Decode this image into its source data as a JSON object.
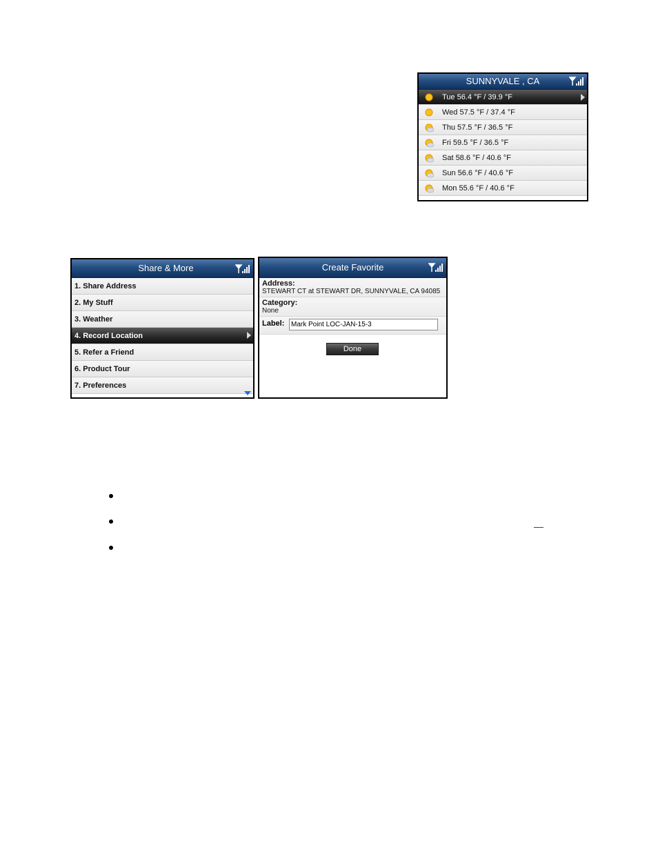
{
  "weather": {
    "title": "SUNNYVALE , CA",
    "days": [
      {
        "text": "Tue 56.4 °F / 39.9 °F",
        "icon": "sun-icon"
      },
      {
        "text": "Wed 57.5 °F / 37.4 °F",
        "icon": "sun-icon"
      },
      {
        "text": "Thu 57.5 °F / 36.5 °F",
        "icon": "partly-cloudy-icon"
      },
      {
        "text": "Fri 59.5 °F / 36.5 °F",
        "icon": "partly-cloudy-icon"
      },
      {
        "text": "Sat 58.6 °F / 40.6 °F",
        "icon": "cloudy-icon"
      },
      {
        "text": "Sun 56.6 °F / 40.6 °F",
        "icon": "cloudy-icon"
      },
      {
        "text": "Mon 55.6 °F / 40.6 °F",
        "icon": "cloudy-icon"
      }
    ]
  },
  "share_menu": {
    "title": "Share & More",
    "items": [
      "1. Share Address",
      "2. My Stuff",
      "3. Weather",
      "4. Record Location",
      "5. Refer a Friend",
      "6. Product Tour",
      "7. Preferences"
    ],
    "selected_index": 3
  },
  "create_favorite": {
    "title": "Create Favorite",
    "address_label": "Address:",
    "address_value": "STEWART CT at STEWART DR, SUNNYVALE, CA 94085",
    "category_label": "Category:",
    "category_value": "None",
    "label_label": "Label:",
    "label_value": "Mark Point LOC-JAN-15-3",
    "done_button": "Done"
  },
  "colors": {
    "titlebar": "#244d80",
    "selected_row": "#2b2b2b",
    "scroll_arrow": "#1f6fd0"
  }
}
